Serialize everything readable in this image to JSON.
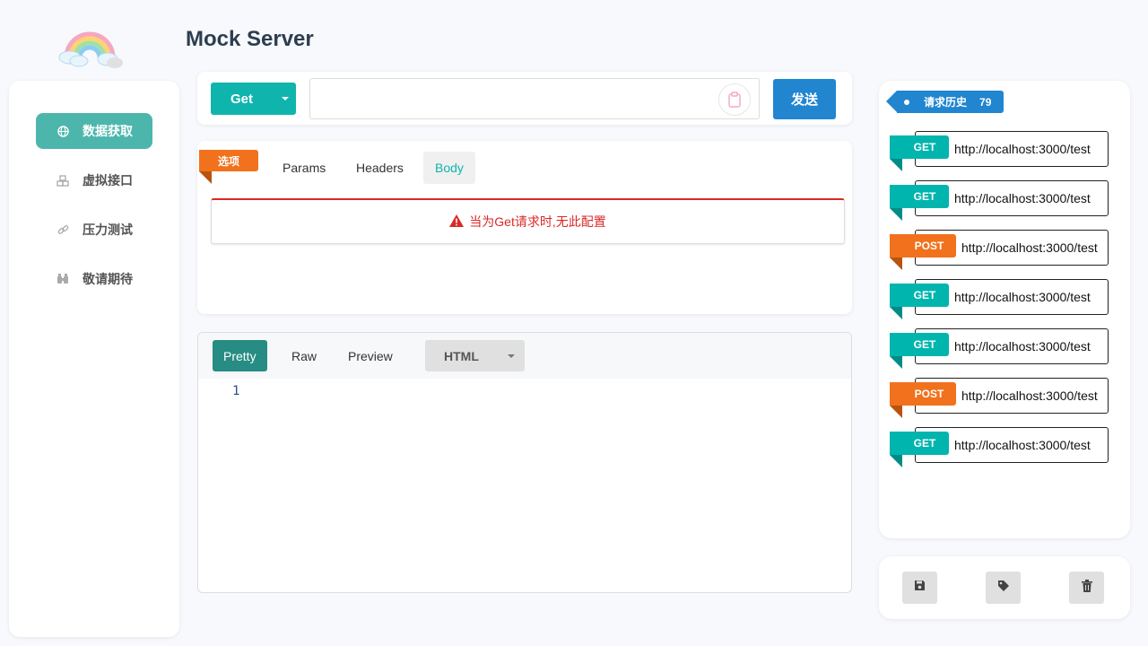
{
  "app": {
    "title": "Mock Server"
  },
  "sidebar": {
    "items": [
      {
        "label": "数据获取",
        "icon": "globe-icon",
        "active": true
      },
      {
        "label": "虚拟接口",
        "icon": "cubes-icon",
        "active": false
      },
      {
        "label": "压力测试",
        "icon": "link-icon",
        "active": false
      },
      {
        "label": "敬请期待",
        "icon": "binoculars-icon",
        "active": false
      }
    ]
  },
  "request": {
    "method": "Get",
    "url_value": "",
    "url_placeholder": "",
    "send_label": "发送"
  },
  "options": {
    "ribbon_label": "选项",
    "tabs": [
      "Params",
      "Headers",
      "Body"
    ],
    "active_tab": "Body",
    "warning": "当为Get请求时,无此配置"
  },
  "response": {
    "tabs": [
      "Pretty",
      "Raw",
      "Preview"
    ],
    "active_tab": "Pretty",
    "format": "HTML",
    "line_numbers": [
      "1"
    ]
  },
  "history": {
    "label": "请求历史",
    "count": "79",
    "items": [
      {
        "method": "GET",
        "url": "http://localhost:3000/test"
      },
      {
        "method": "GET",
        "url": "http://localhost:3000/test"
      },
      {
        "method": "POST",
        "url": "http://localhost:3000/test"
      },
      {
        "method": "GET",
        "url": "http://localhost:3000/test"
      },
      {
        "method": "GET",
        "url": "http://localhost:3000/test"
      },
      {
        "method": "POST",
        "url": "http://localhost:3000/test"
      },
      {
        "method": "GET",
        "url": "http://localhost:3000/test"
      }
    ]
  },
  "actions": [
    {
      "icon": "save-icon"
    },
    {
      "icon": "tag-icon"
    },
    {
      "icon": "trash-icon"
    }
  ],
  "colors": {
    "teal": "#00b5ad",
    "blue": "#2185d0",
    "orange": "#f2711c",
    "red": "#db2828"
  }
}
